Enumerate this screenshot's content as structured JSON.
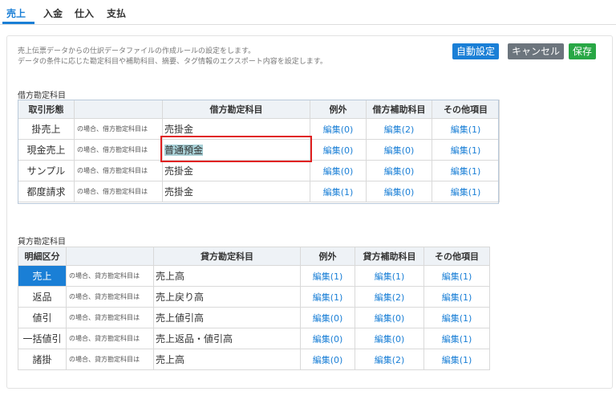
{
  "tabs": [
    {
      "label": "売上",
      "active": true
    },
    {
      "label": "入金",
      "active": false
    },
    {
      "label": "仕入",
      "active": false
    },
    {
      "label": "支払",
      "active": false
    }
  ],
  "description": {
    "line1": "売上伝票データからの仕訳データファイルの作成ルールの設定をします。",
    "line2": "データの条件に応じた勘定科目や補助科目、摘要、タグ情報のエクスポート内容を設定します。"
  },
  "buttons": {
    "auto": "自動設定",
    "cancel": "キャンセル",
    "save": "保存"
  },
  "debit": {
    "title": "借方勘定科目",
    "headers": [
      "取引形態",
      "",
      "借方勘定科目",
      "例外",
      "借方補助科目",
      "その他項目"
    ],
    "rows": [
      {
        "type": "掛売上",
        "cond": "の場合、借方勘定科目は",
        "account": "売掛金",
        "ex": "編集(0)",
        "sub": "編集(2)",
        "other": "編集(1)"
      },
      {
        "type": "現金売上",
        "cond": "の場合、借方勘定科目は",
        "account": "普通預金",
        "ex": "編集(0)",
        "sub": "編集(0)",
        "other": "編集(1)"
      },
      {
        "type": "サンプル",
        "cond": "の場合、借方勘定科目は",
        "account": "売掛金",
        "ex": "編集(0)",
        "sub": "編集(0)",
        "other": "編集(1)"
      },
      {
        "type": "都度請求",
        "cond": "の場合、借方勘定科目は",
        "account": "売掛金",
        "ex": "編集(1)",
        "sub": "編集(0)",
        "other": "編集(1)"
      }
    ]
  },
  "credit": {
    "title": "貸方勘定科目",
    "headers": [
      "明細区分",
      "",
      "貸方勘定科目",
      "例外",
      "貸方補助科目",
      "その他項目"
    ],
    "rows": [
      {
        "type": "売上",
        "cond": "の場合、貸方勘定科目は",
        "account": "売上高",
        "ex": "編集(1)",
        "sub": "編集(1)",
        "other": "編集(1)"
      },
      {
        "type": "返品",
        "cond": "の場合、貸方勘定科目は",
        "account": "売上戻り高",
        "ex": "編集(1)",
        "sub": "編集(2)",
        "other": "編集(1)"
      },
      {
        "type": "値引",
        "cond": "の場合、貸方勘定科目は",
        "account": "売上値引高",
        "ex": "編集(0)",
        "sub": "編集(0)",
        "other": "編集(1)"
      },
      {
        "type": "一括値引",
        "cond": "の場合、貸方勘定科目は",
        "account": "売上返品・値引高",
        "ex": "編集(0)",
        "sub": "編集(0)",
        "other": "編集(1)"
      },
      {
        "type": "諸掛",
        "cond": "の場合、貸方勘定科目は",
        "account": "売上高",
        "ex": "編集(0)",
        "sub": "編集(2)",
        "other": "編集(1)"
      }
    ]
  }
}
